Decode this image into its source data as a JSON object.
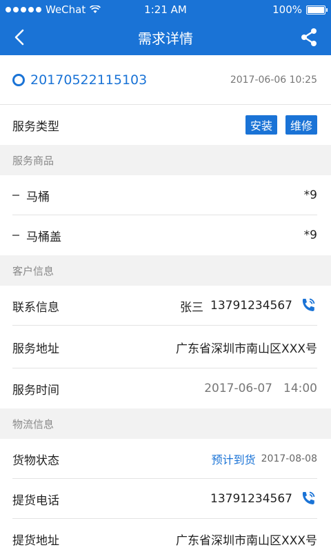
{
  "statusbar": {
    "carrier": "WeChat",
    "time": "1:21 AM",
    "battery": "100%"
  },
  "navbar": {
    "title": "需求详情"
  },
  "order": {
    "number": "20170522115103",
    "datetime": "2017-06-06 10:25"
  },
  "service_type": {
    "label": "服务类型",
    "tags": [
      "安装",
      "维修"
    ]
  },
  "goods": {
    "header": "服务商品",
    "items": [
      {
        "name": "马桶",
        "qty": "*9"
      },
      {
        "name": "马桶盖",
        "qty": "*9"
      }
    ]
  },
  "customer": {
    "header": "客户信息",
    "contact_label": "联系信息",
    "contact_name": "张三",
    "contact_phone": "13791234567",
    "address_label": "服务地址",
    "address": "广东省深圳市南山区XXX号",
    "time_label": "服务时间",
    "date": "2017-06-07",
    "time": "14:00"
  },
  "logistics": {
    "header": "物流信息",
    "status_label": "货物状态",
    "status": "预计到货",
    "status_date": "2017-08-08",
    "phone_label": "提货电话",
    "phone": "13791234567",
    "address_label": "提货地址",
    "address": "广东省深圳市南山区XXX号"
  },
  "colors": {
    "primary": "#1a73d6",
    "background": "#f2f2f2"
  }
}
